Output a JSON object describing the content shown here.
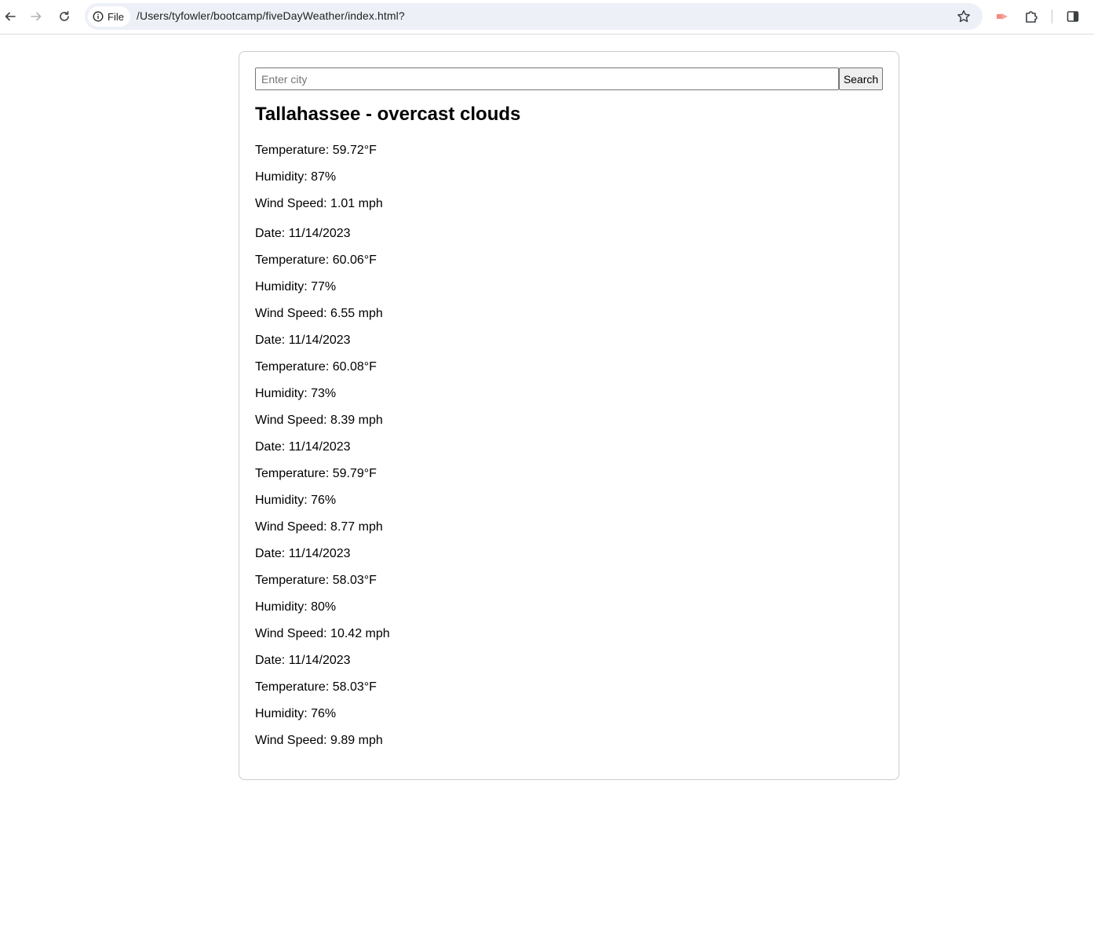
{
  "browser": {
    "file_chip_label": "File",
    "url": "/Users/tyfowler/bootcamp/fiveDayWeather/index.html?"
  },
  "search": {
    "placeholder": "Enter city",
    "value": "",
    "button_label": "Search"
  },
  "current": {
    "title": "Tallahassee - overcast clouds",
    "temperature": "Temperature: 59.72°F",
    "humidity": "Humidity: 87%",
    "wind": "Wind Speed: 1.01 mph"
  },
  "forecast": [
    {
      "date": "Date: 11/14/2023",
      "temperature": "Temperature: 60.06°F",
      "humidity": "Humidity: 77%",
      "wind": "Wind Speed: 6.55 mph"
    },
    {
      "date": "Date: 11/14/2023",
      "temperature": "Temperature: 60.08°F",
      "humidity": "Humidity: 73%",
      "wind": "Wind Speed: 8.39 mph"
    },
    {
      "date": "Date: 11/14/2023",
      "temperature": "Temperature: 59.79°F",
      "humidity": "Humidity: 76%",
      "wind": "Wind Speed: 8.77 mph"
    },
    {
      "date": "Date: 11/14/2023",
      "temperature": "Temperature: 58.03°F",
      "humidity": "Humidity: 80%",
      "wind": "Wind Speed: 10.42 mph"
    },
    {
      "date": "Date: 11/14/2023",
      "temperature": "Temperature: 58.03°F",
      "humidity": "Humidity: 76%",
      "wind": "Wind Speed: 9.89 mph"
    }
  ]
}
